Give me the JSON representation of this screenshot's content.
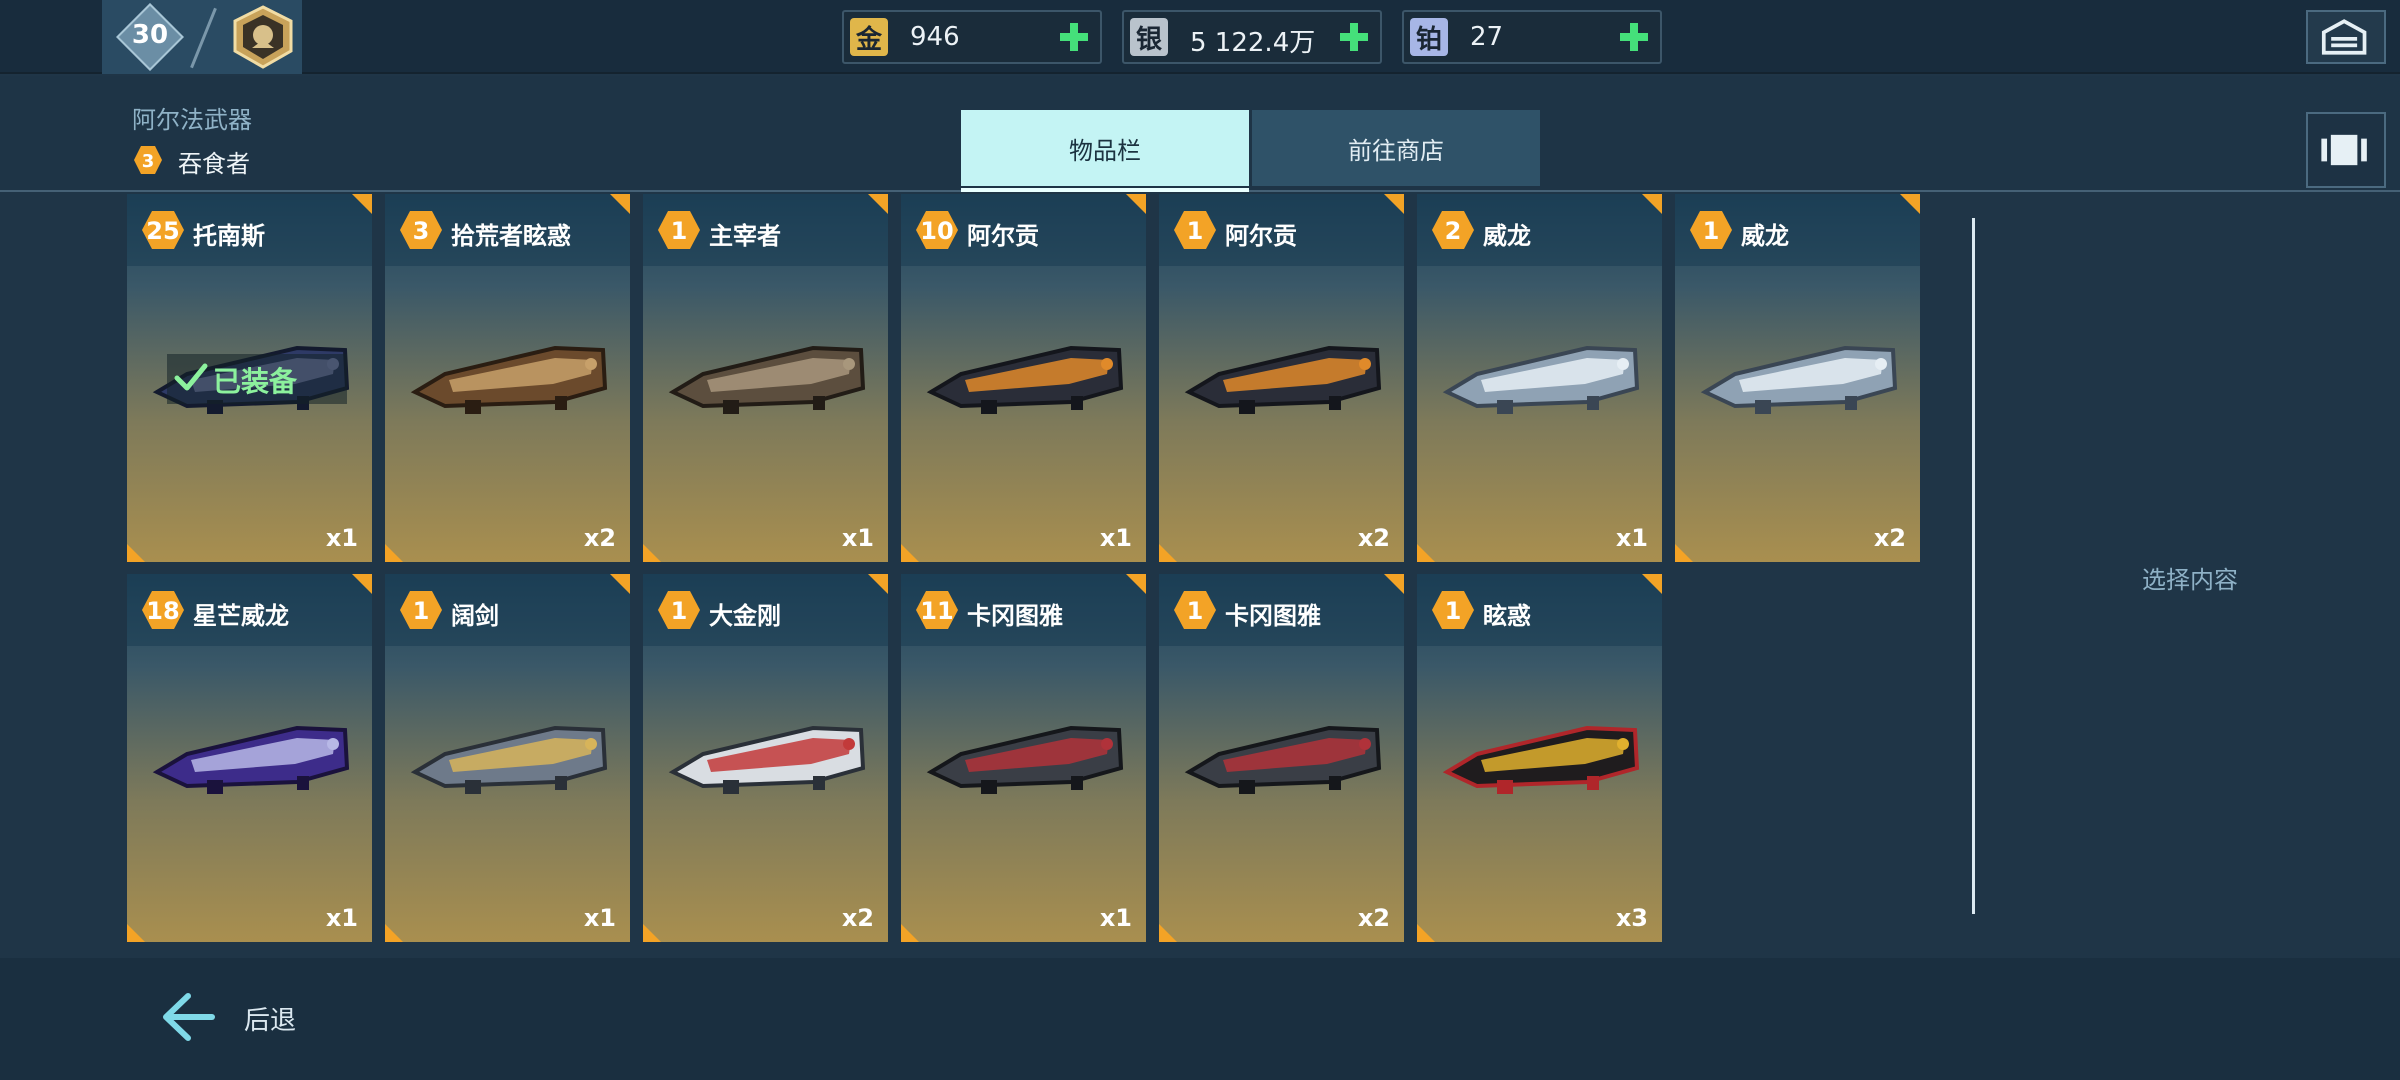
{
  "topbar": {
    "level": "30",
    "rank_icon": "rank-emblem-icon",
    "currencies": [
      {
        "icon_label": "金",
        "value": "946",
        "color": "#e0b64a"
      },
      {
        "icon_label": "银",
        "value": "5 122.4万",
        "color": "#b9c3cc"
      },
      {
        "icon_label": "铂",
        "value": "27",
        "color": "#a7b6e6"
      }
    ],
    "garage_icon": "garage-icon"
  },
  "header": {
    "weapon_type": "阿尔法武器",
    "weapon_rank": "3",
    "weapon_name": "吞食者",
    "tabs": [
      {
        "label": "物品栏",
        "active": true
      },
      {
        "label": "前往商店",
        "active": false
      }
    ],
    "layout_icon": "layout-toggle-icon"
  },
  "colors": {
    "accent_orange": "#f3a326",
    "tab_active": "#c4f4f4",
    "plus_green": "#45e07a",
    "equipped_green": "#8cf19d"
  },
  "items": [
    {
      "rank": "25",
      "name": "托南斯",
      "qty": "x1",
      "equipped": true,
      "equipped_label": "已装备"
    },
    {
      "rank": "3",
      "name": "拾荒者眩惑",
      "qty": "x2"
    },
    {
      "rank": "1",
      "name": "主宰者",
      "qty": "x1"
    },
    {
      "rank": "10",
      "name": "阿尔贡",
      "qty": "x1"
    },
    {
      "rank": "1",
      "name": "阿尔贡",
      "qty": "x2"
    },
    {
      "rank": "2",
      "name": "威龙",
      "qty": "x1"
    },
    {
      "rank": "1",
      "name": "威龙",
      "qty": "x2"
    },
    {
      "rank": "18",
      "name": "星芒威龙",
      "qty": "x1"
    },
    {
      "rank": "1",
      "name": "阔剑",
      "qty": "x1"
    },
    {
      "rank": "1",
      "name": "大金刚",
      "qty": "x2"
    },
    {
      "rank": "11",
      "name": "卡冈图雅",
      "qty": "x1"
    },
    {
      "rank": "1",
      "name": "卡冈图雅",
      "qty": "x2"
    },
    {
      "rank": "1",
      "name": "眩惑",
      "qty": "x3"
    }
  ],
  "detail_panel": {
    "placeholder": "选择内容"
  },
  "footer": {
    "back_label": "后退"
  }
}
